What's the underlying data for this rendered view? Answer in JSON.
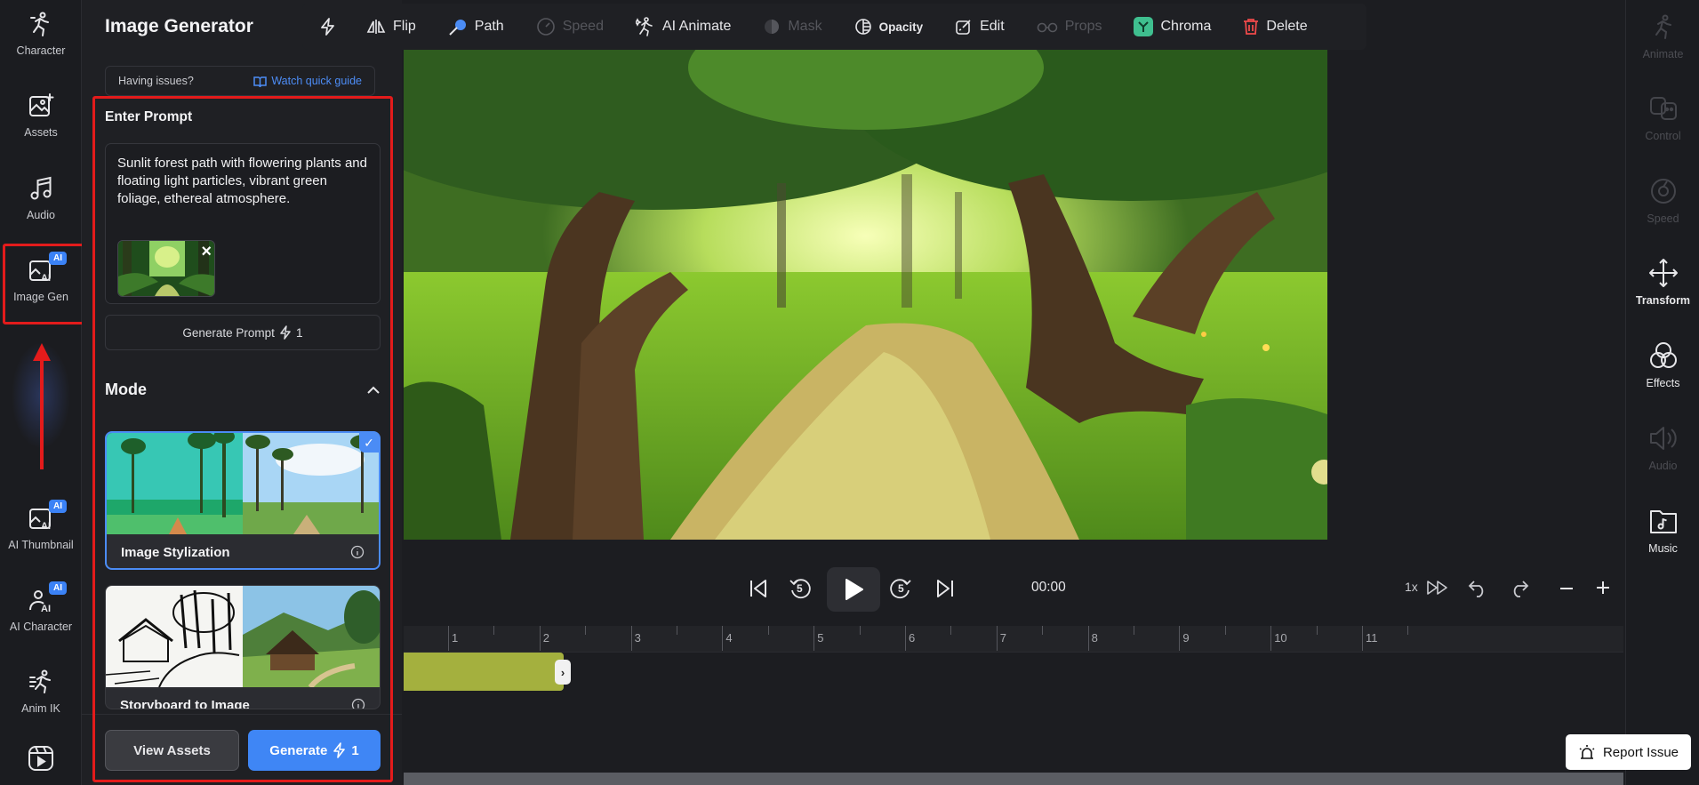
{
  "left_rail": {
    "items": [
      {
        "label": "Character",
        "icon": "character-icon"
      },
      {
        "label": "Assets",
        "icon": "image-plus-icon"
      },
      {
        "label": "Audio",
        "icon": "music-note-icon"
      },
      {
        "label": "Image Gen",
        "icon": "ai-image-icon",
        "badge": "AI"
      },
      {
        "label": "AI Thumbnail",
        "icon": "ai-thumbnail-icon",
        "badge": "AI"
      },
      {
        "label": "AI Character",
        "icon": "ai-character-icon",
        "badge": "AI"
      },
      {
        "label": "Anim IK",
        "icon": "anim-ik-icon"
      }
    ]
  },
  "panel": {
    "title": "Image Generator",
    "help_text": "Having issues?",
    "guide_link": "Watch quick guide",
    "prompt_heading": "Enter Prompt",
    "prompt_value": "Sunlit forest path with flowering plants and floating light particles, vibrant green foliage, ethereal atmosphere.",
    "generate_prompt_label": "Generate Prompt",
    "generate_prompt_cost": "1",
    "mode_heading": "Mode",
    "modes": [
      {
        "label": "Image Stylization",
        "selected": true
      },
      {
        "label": "Storyboard to Image",
        "selected": false
      }
    ],
    "view_assets_label": "View Assets",
    "generate_label": "Generate",
    "generate_cost": "1"
  },
  "toolbar": {
    "items": [
      {
        "label": "",
        "icon": "lightning-icon",
        "enabled": true
      },
      {
        "label": "Flip",
        "icon": "flip-icon",
        "enabled": true
      },
      {
        "label": "Path",
        "icon": "path-icon",
        "enabled": true
      },
      {
        "label": "Speed",
        "icon": "speed-icon",
        "enabled": false
      },
      {
        "label": "AI Animate",
        "icon": "ai-animate-icon",
        "enabled": true
      },
      {
        "label": "Mask",
        "icon": "mask-icon",
        "enabled": false
      },
      {
        "label": "Opacity",
        "icon": "opacity-icon",
        "enabled": true
      },
      {
        "label": "Edit",
        "icon": "edit-icon",
        "enabled": true
      },
      {
        "label": "Props",
        "icon": "props-icon",
        "enabled": false
      },
      {
        "label": "Chroma",
        "icon": "chroma-icon",
        "enabled": true
      },
      {
        "label": "Delete",
        "icon": "trash-icon",
        "enabled": true
      }
    ]
  },
  "transport": {
    "timecode": "00:00",
    "speed": "1x",
    "skip_back": "5",
    "skip_forward": "5"
  },
  "timeline": {
    "ticks": [
      "1",
      "2",
      "3",
      "4",
      "5",
      "6",
      "7",
      "8",
      "9",
      "10",
      "11"
    ]
  },
  "right_rail": {
    "items": [
      {
        "label": "Animate",
        "icon": "animate-icon",
        "enabled": false
      },
      {
        "label": "Control",
        "icon": "control-icon",
        "enabled": false
      },
      {
        "label": "Speed",
        "icon": "speed-icon",
        "enabled": false
      },
      {
        "label": "Transform",
        "icon": "move-icon",
        "enabled": true
      },
      {
        "label": "Effects",
        "icon": "effects-icon",
        "enabled": true
      },
      {
        "label": "Audio",
        "icon": "volume-icon",
        "enabled": false
      },
      {
        "label": "Music",
        "icon": "music-folder-icon",
        "enabled": true
      }
    ]
  },
  "report_label": "Report Issue",
  "colors": {
    "accent": "#3f86f5",
    "highlight": "#e31b1b",
    "clip": "#a4b03e"
  }
}
